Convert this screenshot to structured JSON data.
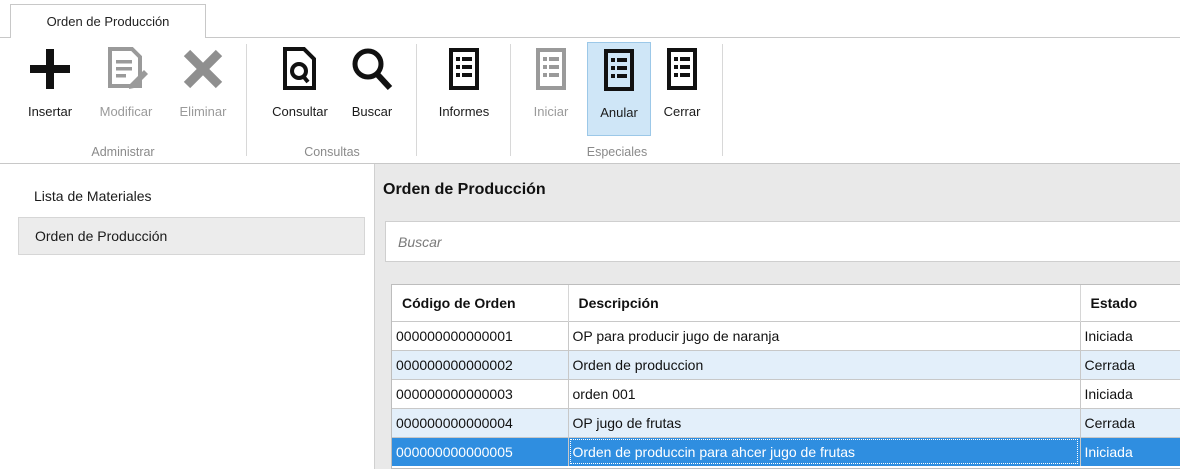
{
  "ribbon": {
    "tab_label": "Orden de Producción",
    "groups": {
      "administrar": "Administrar",
      "consultas": "Consultas",
      "especiales": "Especiales"
    },
    "buttons": {
      "insertar": "Insertar",
      "modificar": "Modificar",
      "eliminar": "Eliminar",
      "consultar": "Consultar",
      "buscar": "Buscar",
      "informes": "Informes",
      "iniciar": "Iniciar",
      "anular": "Anular",
      "cerrar": "Cerrar"
    },
    "icons": {
      "insertar": "plus-icon",
      "modificar": "edit-document-icon",
      "eliminar": "x-delete-icon",
      "consultar": "document-search-icon",
      "buscar": "magnifier-icon",
      "informes": "list-report-icon",
      "iniciar": "list-report-icon",
      "anular": "list-report-icon",
      "cerrar": "list-report-icon"
    },
    "accent_active": "#cfe6f7"
  },
  "nav": {
    "items": [
      {
        "label": "Lista de Materiales"
      },
      {
        "label": "Orden de Producción"
      }
    ]
  },
  "main": {
    "title": "Orden de Producción",
    "search_placeholder": "Buscar",
    "columns": [
      "Código de Orden",
      "Descripción",
      "Estado"
    ],
    "rows": [
      [
        "000000000000001",
        "OP para producir jugo de naranja",
        "Iniciada"
      ],
      [
        "000000000000002",
        "Orden de produccion",
        "Cerrada"
      ],
      [
        "000000000000003",
        "orden 001",
        "Iniciada"
      ],
      [
        "000000000000004",
        "OP jugo de frutas",
        "Cerrada"
      ],
      [
        "000000000000005",
        "Orden de produccin para ahcer jugo de frutas",
        "Iniciada"
      ]
    ],
    "selection_color": "#2f8ee0",
    "alt_row_color": "#e3effa"
  }
}
